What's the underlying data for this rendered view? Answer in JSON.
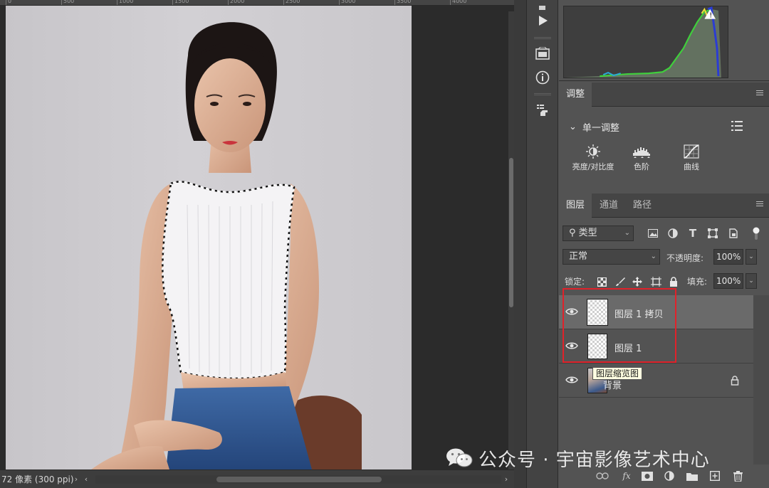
{
  "ruler": {
    "ticks": [
      "0",
      "500",
      "1000",
      "1500",
      "2000",
      "2500",
      "3000",
      "3500",
      "4000"
    ]
  },
  "status": {
    "text": "72 像素 (300 ppi)",
    "arrow": "›",
    "scroll_left": "‹",
    "scroll_right": "›"
  },
  "adjustments": {
    "tab": "调整",
    "header": "单一调整",
    "items": [
      {
        "label": "亮度/对比度",
        "icon": "brightness-contrast-icon"
      },
      {
        "label": "色阶",
        "icon": "levels-icon"
      },
      {
        "label": "曲线",
        "icon": "curves-icon"
      }
    ]
  },
  "layers_panel": {
    "tabs": [
      "图层",
      "通道",
      "路径"
    ],
    "filter": {
      "label": "类型",
      "icon": "search-icon"
    },
    "blend_mode": "正常",
    "opacity_label": "不透明度:",
    "opacity_value": "100%",
    "lock_label": "锁定:",
    "fill_label": "填充:",
    "fill_value": "100%",
    "layers": [
      {
        "name": "图层 1 拷贝",
        "selected": true
      },
      {
        "name": "图层 1",
        "selected": false
      },
      {
        "name": "背景",
        "locked": true
      }
    ],
    "tooltip": "图层缩览图",
    "footer_fx": "fx"
  },
  "watermark": {
    "text": "公众号 · 宇宙影像艺术中心"
  },
  "colors": {
    "panel_bg": "#535353",
    "highlight": "#e0222a",
    "tooltip_bg": "#ffffe1"
  }
}
